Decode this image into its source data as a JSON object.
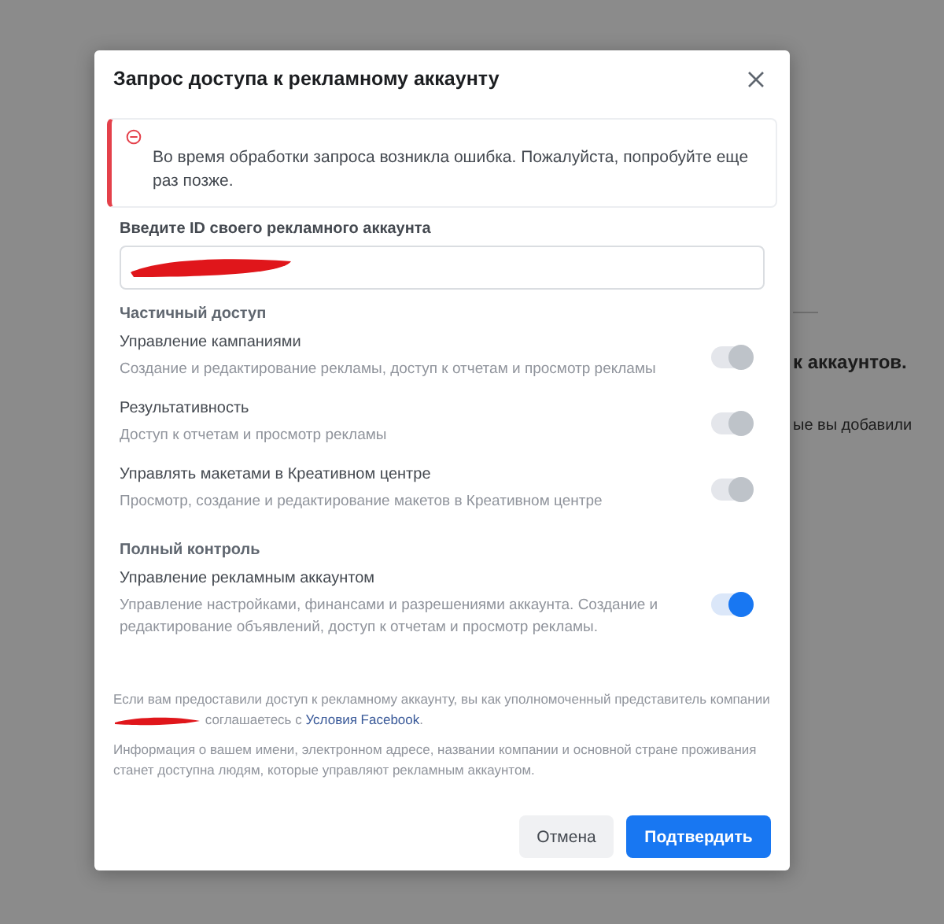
{
  "background": {
    "heading": "к аккаунтов.",
    "text": "ые вы добавили"
  },
  "dialog": {
    "title": "Запрос доступа к рекламному аккаунту",
    "error": "Во время обработки запроса возникла ошибка. Пожалуйста, попробуйте еще раз позже.",
    "id_label": "Введите ID своего рекламного аккаунта",
    "sections": [
      {
        "title": "Частичный доступ",
        "permissions": [
          {
            "name": "Управление кампаниями",
            "description": "Создание и редактирование рекламы, доступ к отчетам и просмотр рекламы",
            "on": true,
            "disabled": true
          },
          {
            "name": "Результативность",
            "description": "Доступ к отчетам и просмотр рекламы",
            "on": true,
            "disabled": true
          },
          {
            "name": "Управлять макетами в Креативном центре",
            "description": "Просмотр, создание и редактирование макетов в Креативном центре",
            "on": true,
            "disabled": true
          }
        ]
      },
      {
        "title": "Полный контроль",
        "permissions": [
          {
            "name": "Управление рекламным аккаунтом",
            "description": "Управление настройками, финансами и разрешениями аккаунта. Создание и редактирование объявлений, доступ к отчетам и просмотр рекламы.",
            "on": true,
            "disabled": false
          }
        ]
      }
    ],
    "terms_before": "Если вам предоставили доступ к рекламному аккаунту, вы как уполномоченный представитель компании",
    "terms_after": "соглашаетесь с",
    "terms_link": "Условия Facebook",
    "terms_end": ".",
    "info": "Информация о вашем имени, электронном адресе, названии компании и основной стране проживания станет доступна людям, которые управляют рекламным аккаунтом.",
    "cancel": "Отмена",
    "confirm": "Подтвердить"
  }
}
